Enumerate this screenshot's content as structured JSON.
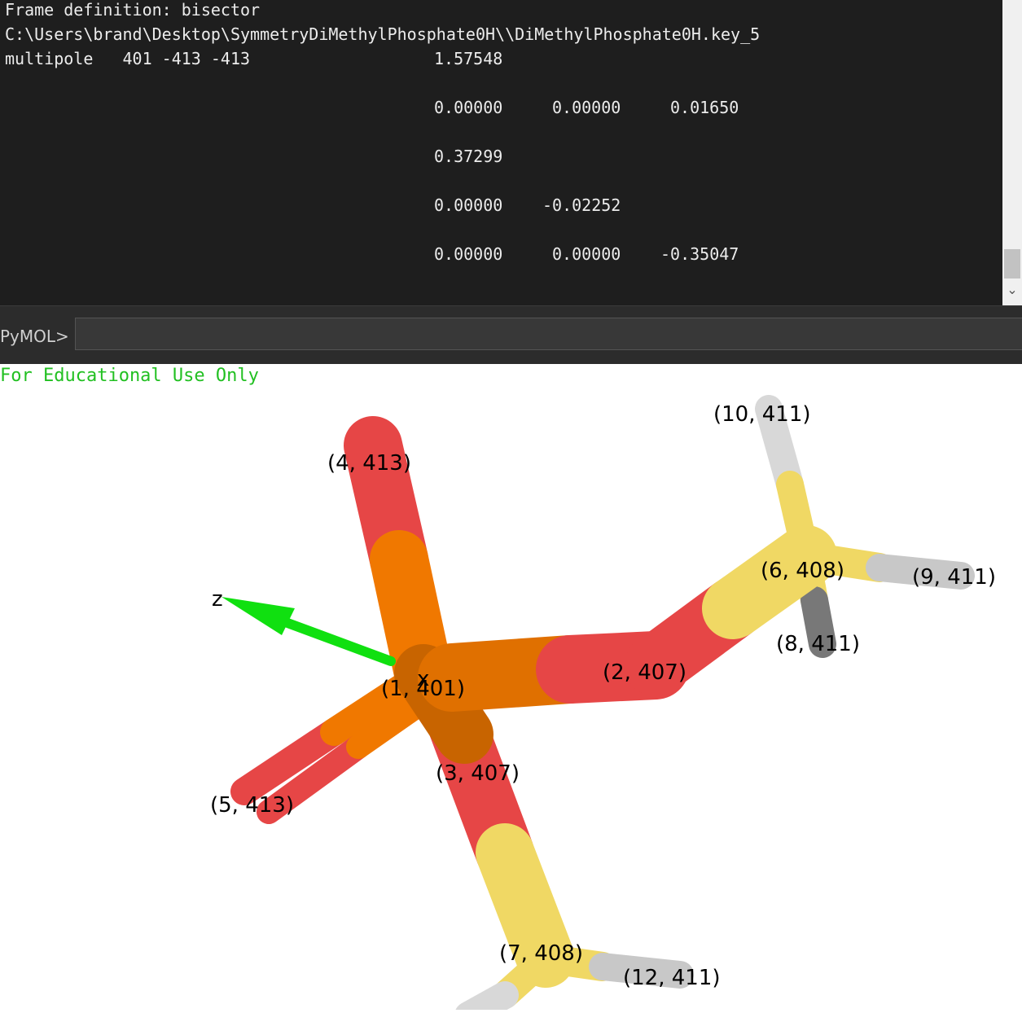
{
  "console": {
    "lines": [
      "Frame definition: bisector",
      "C:\\Users\\brand\\Desktop\\SymmetryDiMethylPhosphate0H\\\\DiMethylPhosphate0H.key_5",
      "multipole   401 -413 -413"
    ],
    "values": {
      "row1": [
        "1.57548"
      ],
      "row2": [
        "0.00000",
        "0.00000",
        "0.01650"
      ],
      "row3": [
        "0.37299"
      ],
      "row4": [
        "0.00000",
        "-0.02252"
      ],
      "row5": [
        "0.00000",
        "0.00000",
        "-0.35047"
      ]
    }
  },
  "command": {
    "prompt": "PyMOL>",
    "value": ""
  },
  "viewer": {
    "watermark": "For Educational Use Only",
    "axis_labels": {
      "z": "z",
      "x": "x"
    },
    "atom_labels": {
      "a1": "(1, 401)",
      "a2": "(2, 407)",
      "a3": "(3, 407)",
      "a4": "(4, 413)",
      "a5": "(5, 413)",
      "a6": "(6, 408)",
      "a7": "(7, 408)",
      "a8": "(8, 411)",
      "a9": "(9, 411)",
      "a10": "(10, 411)",
      "a12": "(12, 411)"
    }
  },
  "colors": {
    "console_bg": "#1e1e1e",
    "console_text": "#ececec",
    "watermark": "#22c022",
    "phosphorus": "#f07800",
    "oxygen": "#e64646",
    "carbon": "#f0d864",
    "hydrogen": "#d2d2d2",
    "axis": "#10e010"
  }
}
